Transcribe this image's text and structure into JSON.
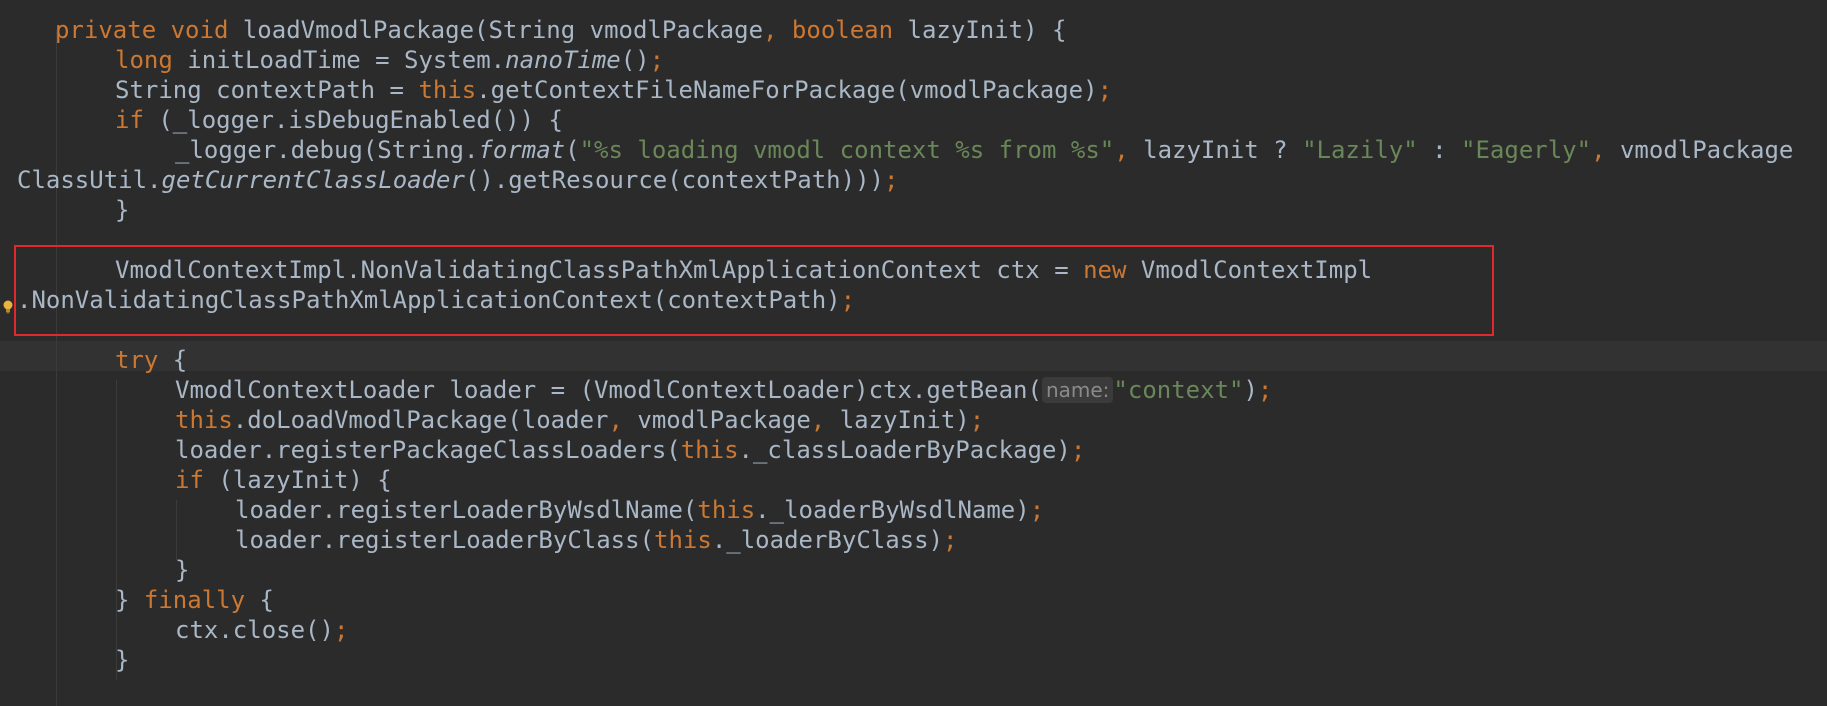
{
  "caret_line": 11,
  "lines": [
    [
      [
        "kw",
        "private void "
      ],
      [
        "pl",
        "loadVmodlPackage(String vmodlPackage"
      ],
      [
        "kw",
        ", boolean "
      ],
      [
        "pl",
        "lazyInit) {"
      ]
    ],
    [
      [
        "kw",
        "long "
      ],
      [
        "pl",
        "initLoadTime = System."
      ],
      [
        "pl",
        "nanoTime"
      ],
      [
        "pl",
        "()"
      ],
      [
        "kw",
        ";"
      ]
    ],
    [
      [
        "pl",
        "String contextPath = "
      ],
      [
        "kw",
        "this"
      ],
      [
        "pl",
        ".getContextFileNameForPackage(vmodlPackage)"
      ],
      [
        "kw",
        ";"
      ]
    ],
    [
      [
        "kw",
        "if "
      ],
      [
        "pl",
        "(_logger.isDebugEnabled()) {"
      ]
    ],
    [
      [
        "pl",
        "_logger.debug(String."
      ],
      [
        "pl",
        "format"
      ],
      [
        "pl",
        "("
      ],
      [
        "str",
        "\"%s loading vmodl context %s from %s\""
      ],
      [
        "kw",
        ", "
      ],
      [
        "pl",
        "lazyInit ? "
      ],
      [
        "str",
        "\"Lazily\""
      ],
      [
        "pl",
        " : "
      ],
      [
        "str",
        "\"Eagerly\""
      ],
      [
        "kw",
        ", "
      ],
      [
        "pl",
        "vmodlPackage"
      ]
    ],
    [
      [
        "pl",
        "ClassUtil."
      ],
      [
        "pl",
        "getCurrentClassLoader"
      ],
      [
        "pl",
        "().getResource(contextPath)))"
      ],
      [
        "kw",
        ";"
      ]
    ],
    [
      [
        "pl",
        "}"
      ]
    ],
    [
      [
        "pl",
        ""
      ]
    ],
    [
      [
        "pl",
        "VmodlContextImpl.NonValidatingClassPathXmlApplicationContext ctx = "
      ],
      [
        "kw",
        "new "
      ],
      [
        "pl",
        "VmodlContextImpl"
      ]
    ],
    [
      [
        "pl",
        ".NonValidatingClassPathXmlApplicationContext(contextPath)"
      ],
      [
        "kw",
        ";"
      ]
    ],
    [
      [
        "pl",
        ""
      ]
    ],
    [
      [
        "kw",
        "try "
      ],
      [
        "pl",
        "{"
      ]
    ],
    [
      [
        "pl",
        "VmodlContextLoader loader = (VmodlContextLoader)ctx.getBean("
      ],
      [
        "hint",
        "name:"
      ],
      [
        "str",
        "\"context\""
      ],
      [
        "pl",
        ")"
      ],
      [
        "kw",
        ";"
      ]
    ],
    [
      [
        "kw",
        "this"
      ],
      [
        "pl",
        ".doLoadVmodlPackage(loader"
      ],
      [
        "kw",
        ", "
      ],
      [
        "pl",
        "vmodlPackage"
      ],
      [
        "kw",
        ", "
      ],
      [
        "pl",
        "lazyInit)"
      ],
      [
        "kw",
        ";"
      ]
    ],
    [
      [
        "pl",
        "loader.registerPackageClassLoaders("
      ],
      [
        "kw",
        "this"
      ],
      [
        "pl",
        "._classLoaderByPackage)"
      ],
      [
        "kw",
        ";"
      ]
    ],
    [
      [
        "kw",
        "if "
      ],
      [
        "pl",
        "(lazyInit) {"
      ]
    ],
    [
      [
        "pl",
        "loader.registerLoaderByWsdlName("
      ],
      [
        "kw",
        "this"
      ],
      [
        "pl",
        "._loaderByWsdlName)"
      ],
      [
        "kw",
        ";"
      ]
    ],
    [
      [
        "pl",
        "loader.registerLoaderByClass("
      ],
      [
        "kw",
        "this"
      ],
      [
        "pl",
        "._loaderByClass)"
      ],
      [
        "kw",
        ";"
      ]
    ],
    [
      [
        "pl",
        "}"
      ]
    ],
    [
      [
        "pl",
        "} "
      ],
      [
        "kw",
        "finally "
      ],
      [
        "pl",
        "{"
      ]
    ],
    [
      [
        "pl",
        "ctx.close()"
      ],
      [
        "kw",
        ";"
      ]
    ],
    [
      [
        "pl",
        "}"
      ]
    ]
  ]
}
